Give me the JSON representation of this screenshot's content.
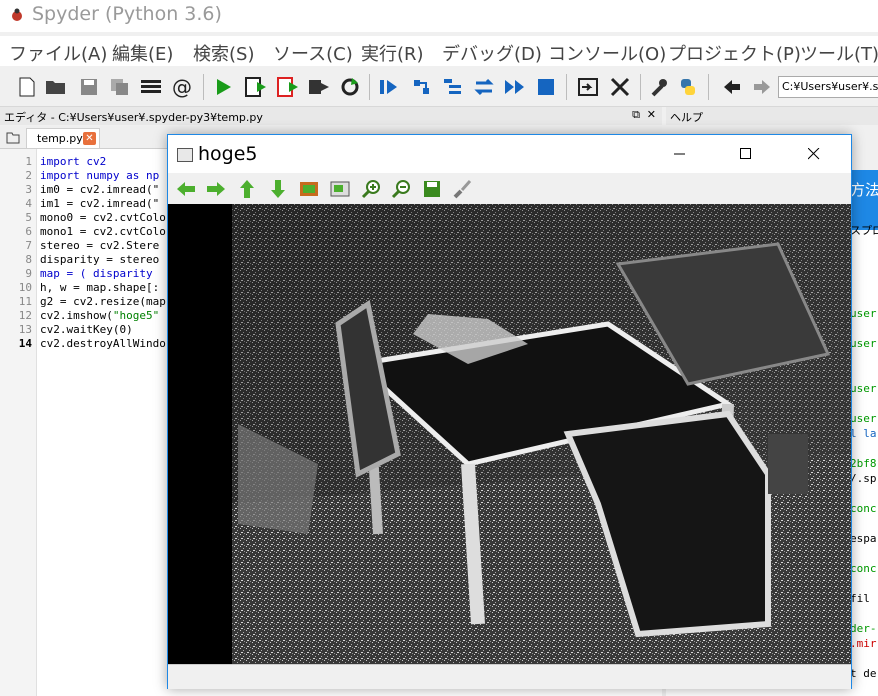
{
  "app": {
    "title": "Spyder (Python 3.6)"
  },
  "menu": [
    "ファイル(A)",
    "編集(E)",
    "検索(S)",
    "ソース(C)",
    "実行(R)",
    "デバッグ(D)",
    "コンソール(O)",
    "プロジェクト(P)",
    "ツール(T)"
  ],
  "toolbar": {
    "path_value": "C:¥Users¥user¥.sp"
  },
  "editor": {
    "pane_title": "エディタ - C:¥Users¥user¥.spyder-py3¥temp.py",
    "tab_label": "temp.py",
    "line_numbers": [
      "1",
      "2",
      "3",
      "4",
      "5",
      "6",
      "7",
      "8",
      "9",
      "10",
      "11",
      "12",
      "13",
      "14"
    ],
    "lines": [
      "import cv2",
      "import numpy as np",
      "im0 = cv2.imread(\"",
      "im1 = cv2.imread(\"",
      "mono0 = cv2.cvtColo",
      "mono1 = cv2.cvtColo",
      "stereo = cv2.Stere",
      "disparity = stereo",
      "map = ( disparity",
      "h, w = map.shape[:",
      "g2 = cv2.resize(map",
      "cv2.imshow(\"hoge5\"",
      "cv2.waitKey(0)",
      "cv2.destroyAllWindo"
    ]
  },
  "help": {
    "pane_title": "ヘルプ",
    "fragments": [
      "user",
      "user",
      "user",
      "user",
      "l la",
      "2bf8",
      "/.sp",
      "conc",
      "espa",
      "conc",
      "fil",
      "der-",
      ".mir",
      "t de",
      "スプロ",
      "方法"
    ]
  },
  "popup": {
    "title": "hoge5"
  },
  "colors": {
    "accent": "#1e88e5",
    "keyword": "#0000cc",
    "string": "#008000"
  }
}
